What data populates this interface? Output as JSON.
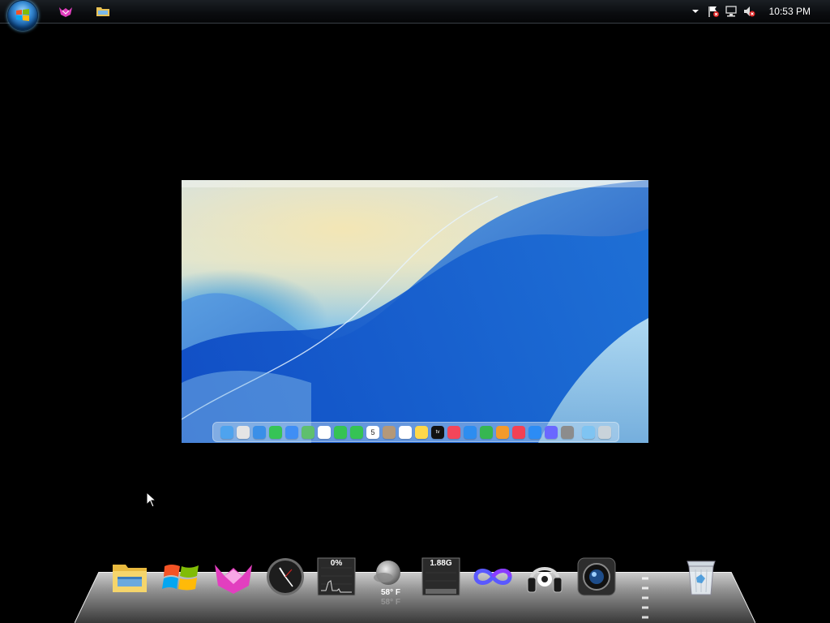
{
  "taskbar": {
    "start_icon": "windows-orb-icon",
    "pinned": [
      {
        "name": "lollipop-cat-icon"
      },
      {
        "name": "folder-icon"
      }
    ],
    "tray": {
      "items": [
        "expand-arrow-icon",
        "action-center-flag-icon",
        "network-icon",
        "volume-muted-icon"
      ],
      "clock": "10:53 PM"
    }
  },
  "mac_preview": {
    "dock_icons": [
      "finder",
      "launchpad",
      "safari",
      "messages",
      "mail",
      "maps",
      "photos",
      "facetime",
      "phone",
      "calendar",
      "contacts",
      "reminders",
      "notes",
      "appletv",
      "music",
      "keynote",
      "numbers",
      "pages",
      "news",
      "appstore",
      "vision",
      "settings",
      "downloads",
      "trash"
    ],
    "calendar_day": "5",
    "appletv_label": "tv"
  },
  "dock": {
    "items": [
      {
        "name": "folder-icon"
      },
      {
        "name": "windows-logo-icon"
      },
      {
        "name": "lollipop-cat-icon"
      },
      {
        "name": "clock-icon"
      },
      {
        "name": "cpu-meter-icon",
        "label": "0%"
      },
      {
        "name": "weather-icon",
        "label": "58° F"
      },
      {
        "name": "memory-meter-icon",
        "label": "1.88G"
      },
      {
        "name": "infinity-icon"
      },
      {
        "name": "headphones-icon"
      },
      {
        "name": "camera-icon"
      },
      {
        "name": "recycle-bin-icon"
      }
    ]
  },
  "colors": {
    "taskbar": "#0a0c0f",
    "desktop": "#000000",
    "accent_blue": "#1a5cbf"
  }
}
